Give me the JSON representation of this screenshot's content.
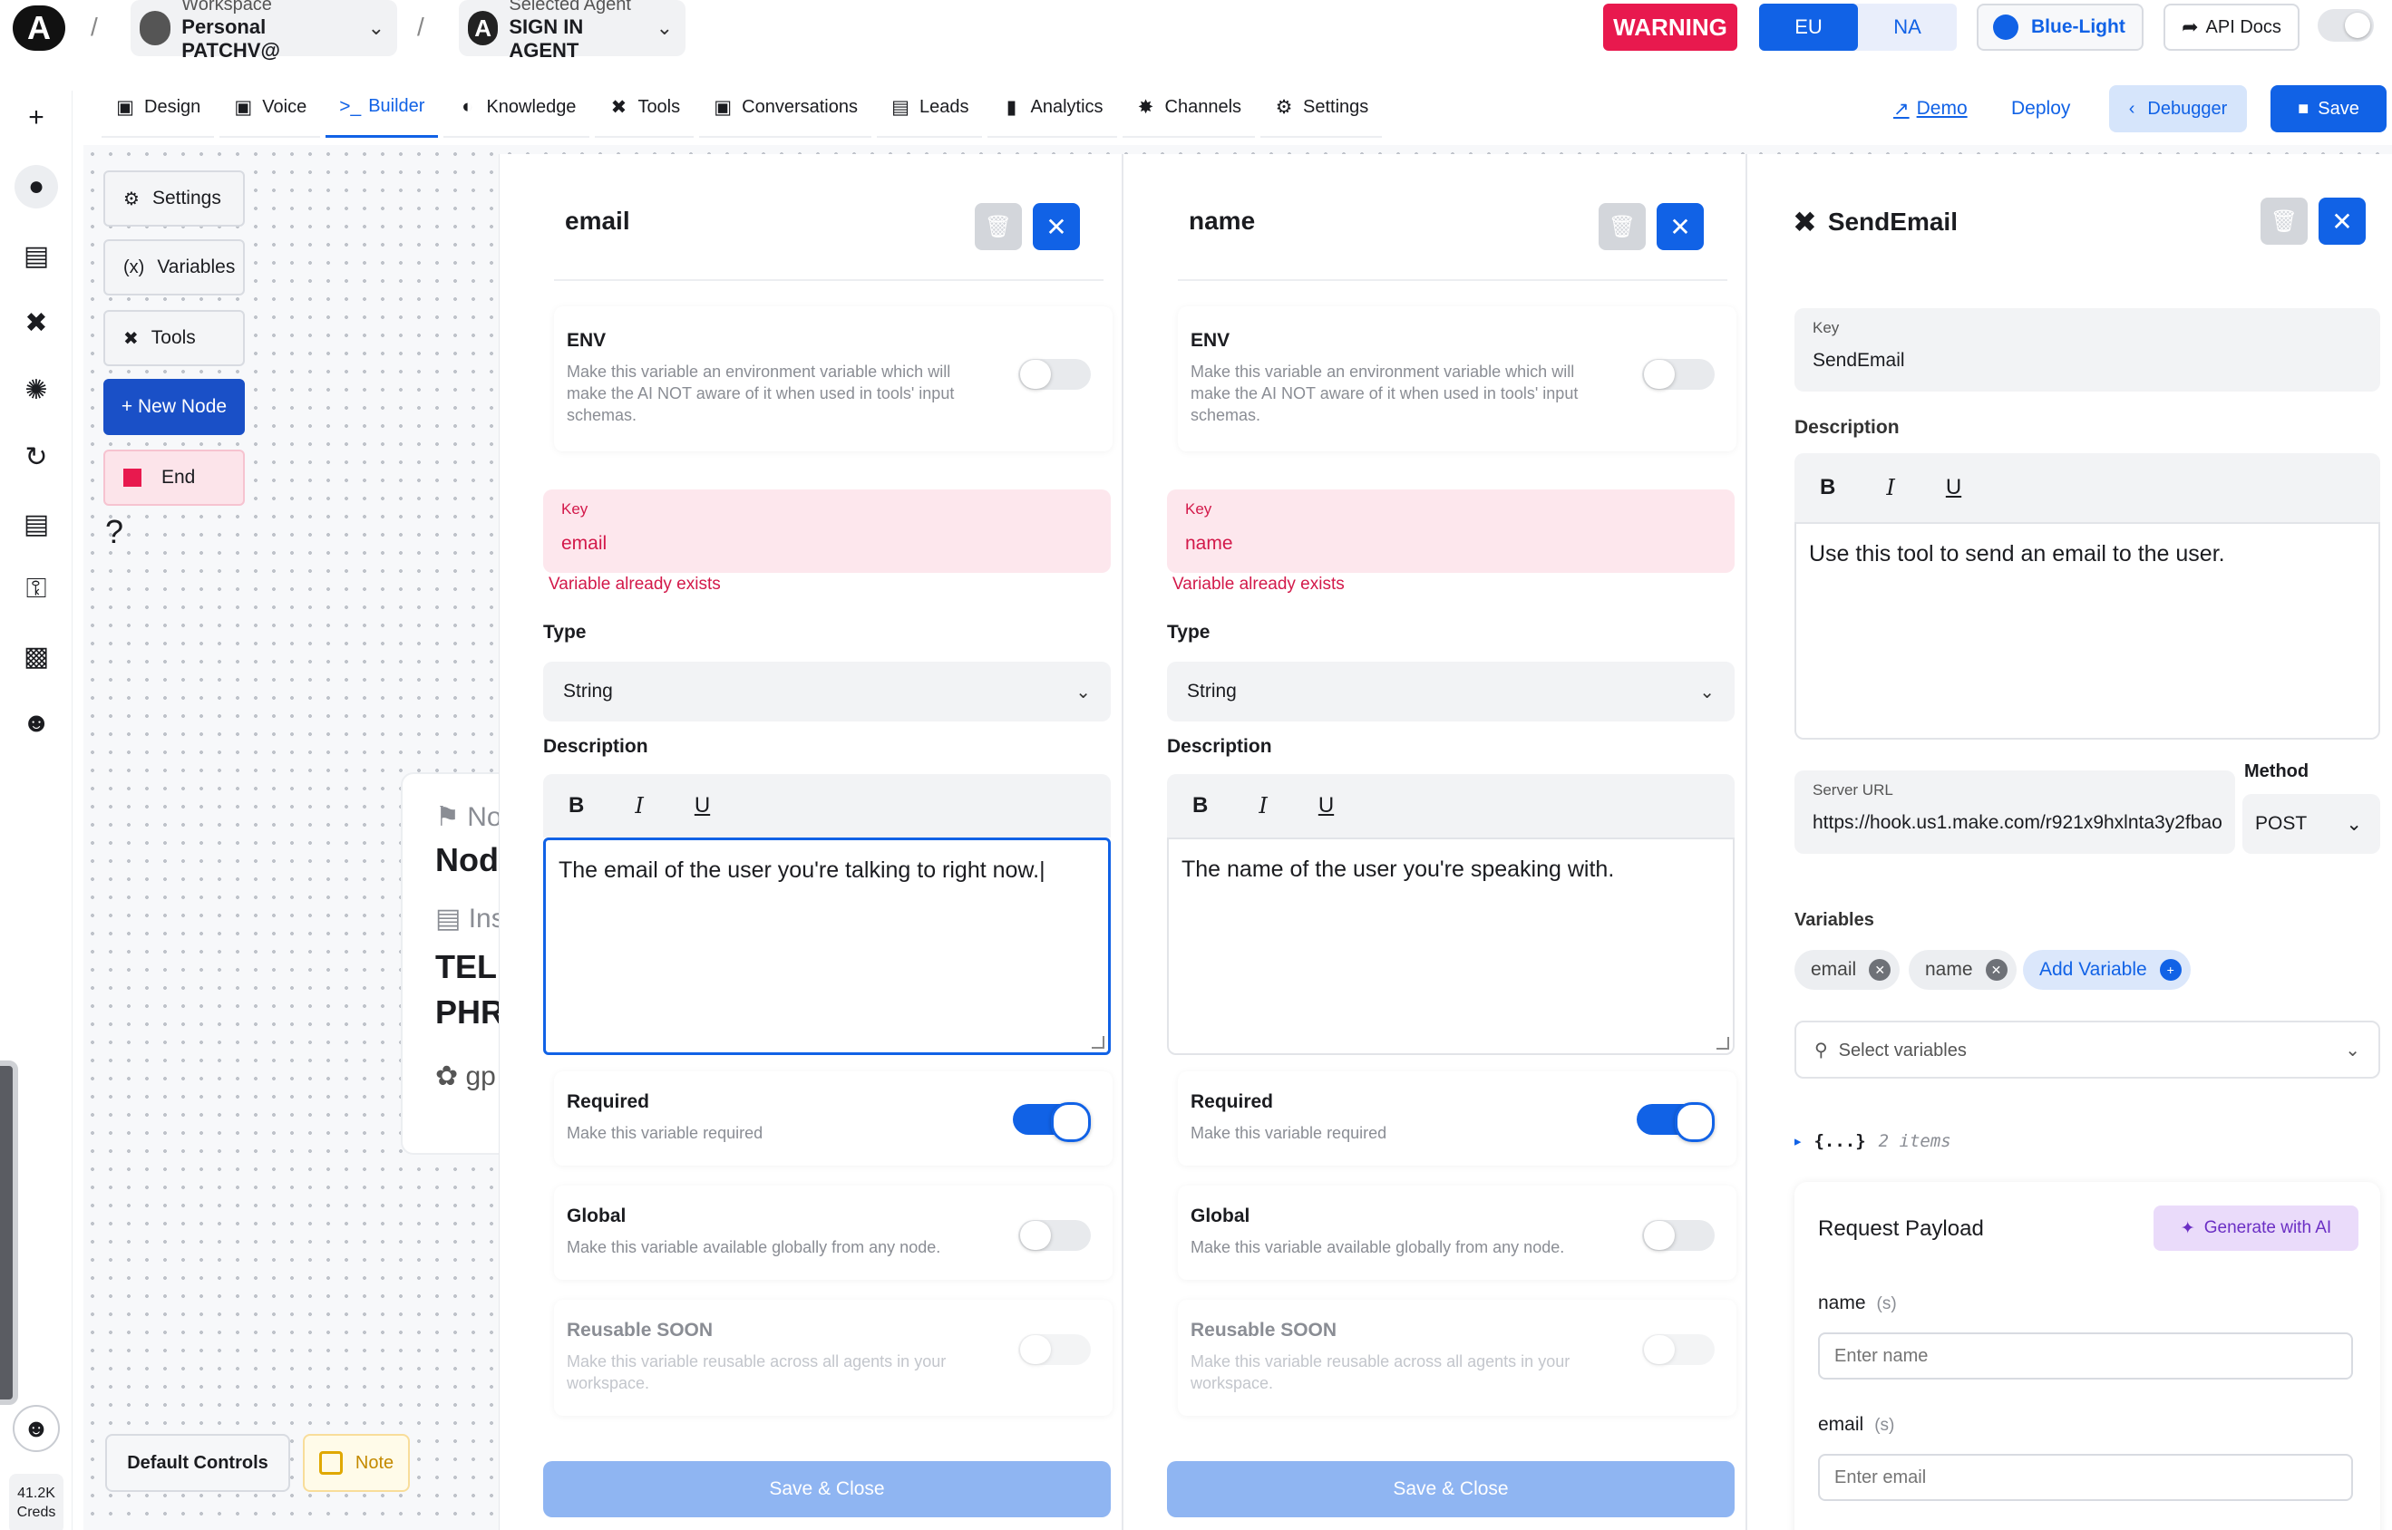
{
  "header": {
    "workspace_label": "Workspace",
    "workspace_name": "Personal PATCHV@",
    "agent_label": "Selected Agent",
    "agent_name": "SIGN IN AGENT",
    "agent_initial": "A",
    "logo_letter": "A",
    "warning": "WARNING",
    "regions": [
      "EU",
      "NA"
    ],
    "theme": "Blue-Light",
    "api_docs": "API Docs"
  },
  "tabs": [
    {
      "label": "Design",
      "icon": "design-icon"
    },
    {
      "label": "Voice",
      "icon": "voice-icon"
    },
    {
      "label": "Builder",
      "icon": "builder-icon",
      "active": true
    },
    {
      "label": "Knowledge",
      "icon": "knowledge-icon"
    },
    {
      "label": "Tools",
      "icon": "tools-icon"
    },
    {
      "label": "Conversations",
      "icon": "conversations-icon"
    },
    {
      "label": "Leads",
      "icon": "leads-icon"
    },
    {
      "label": "Analytics",
      "icon": "analytics-icon"
    },
    {
      "label": "Channels",
      "icon": "channels-icon"
    },
    {
      "label": "Settings",
      "icon": "settings-icon"
    }
  ],
  "actions": {
    "demo": "Demo",
    "deploy": "Deploy",
    "debugger": "Debugger",
    "save": "Save"
  },
  "sidebar": {
    "credits_value": "41.2K",
    "credits_label": "Creds"
  },
  "canvas": {
    "buttons": [
      "Settings",
      "Variables",
      "Tools",
      "+ New Node",
      "End"
    ],
    "help": "?",
    "default_controls": "Default Controls",
    "note": "Note",
    "node_card": {
      "tag": "Noc",
      "title": "Nod",
      "instruction": "Inst",
      "body_line1": "TELL",
      "body_line2": "PHRA",
      "model": "gp"
    }
  },
  "panels": [
    {
      "title": "email",
      "env_title": "ENV",
      "env_desc": "Make this variable an environment variable which will make the AI NOT aware of it when used in tools' input schemas.",
      "key_label": "Key",
      "key_value": "email",
      "key_error": "Variable already exists",
      "type_label": "Type",
      "type_value": "String",
      "description_label": "Description",
      "description_text": "The email of the user you're talking to right now.",
      "required_title": "Required",
      "required_desc": "Make this variable required",
      "required_on": true,
      "global_title": "Global",
      "global_desc": "Make this variable available globally from any node.",
      "reusable_title": "Reusable SOON",
      "reusable_desc": "Make this variable reusable across all agents in your workspace.",
      "save_close": "Save & Close"
    },
    {
      "title": "name",
      "env_title": "ENV",
      "env_desc": "Make this variable an environment variable which will make the AI NOT aware of it when used in tools' input schemas.",
      "key_label": "Key",
      "key_value": "name",
      "key_error": "Variable already exists",
      "type_label": "Type",
      "type_value": "String",
      "description_label": "Description",
      "description_text": "The name of the user you're speaking with.",
      "required_title": "Required",
      "required_desc": "Make this variable required",
      "required_on": true,
      "global_title": "Global",
      "global_desc": "Make this variable available globally from any node.",
      "reusable_title": "Reusable SOON",
      "reusable_desc": "Make this variable reusable across all agents in your workspace.",
      "save_close": "Save & Close"
    }
  ],
  "tool": {
    "title": "SendEmail",
    "key_label": "Key",
    "key_value": "SendEmail",
    "description_label": "Description",
    "description_text": "Use this tool to send an email to the user.",
    "server_url_label": "Server URL",
    "server_url": "https://hook.us1.make.com/r921x9hxlnta3y2fbao",
    "method_label": "Method",
    "method_value": "POST",
    "variables_label": "Variables",
    "variable_chips": [
      "email",
      "name"
    ],
    "add_variable": "Add Variable",
    "select_placeholder": "Select variables",
    "json_preview": "{...}",
    "json_items": "2 items",
    "payload_title": "Request Payload",
    "generate_ai": "Generate with AI",
    "payload_fields": [
      {
        "name": "name",
        "type": "(s)",
        "placeholder": "Enter name"
      },
      {
        "name": "email",
        "type": "(s)",
        "placeholder": "Enter email"
      }
    ]
  }
}
